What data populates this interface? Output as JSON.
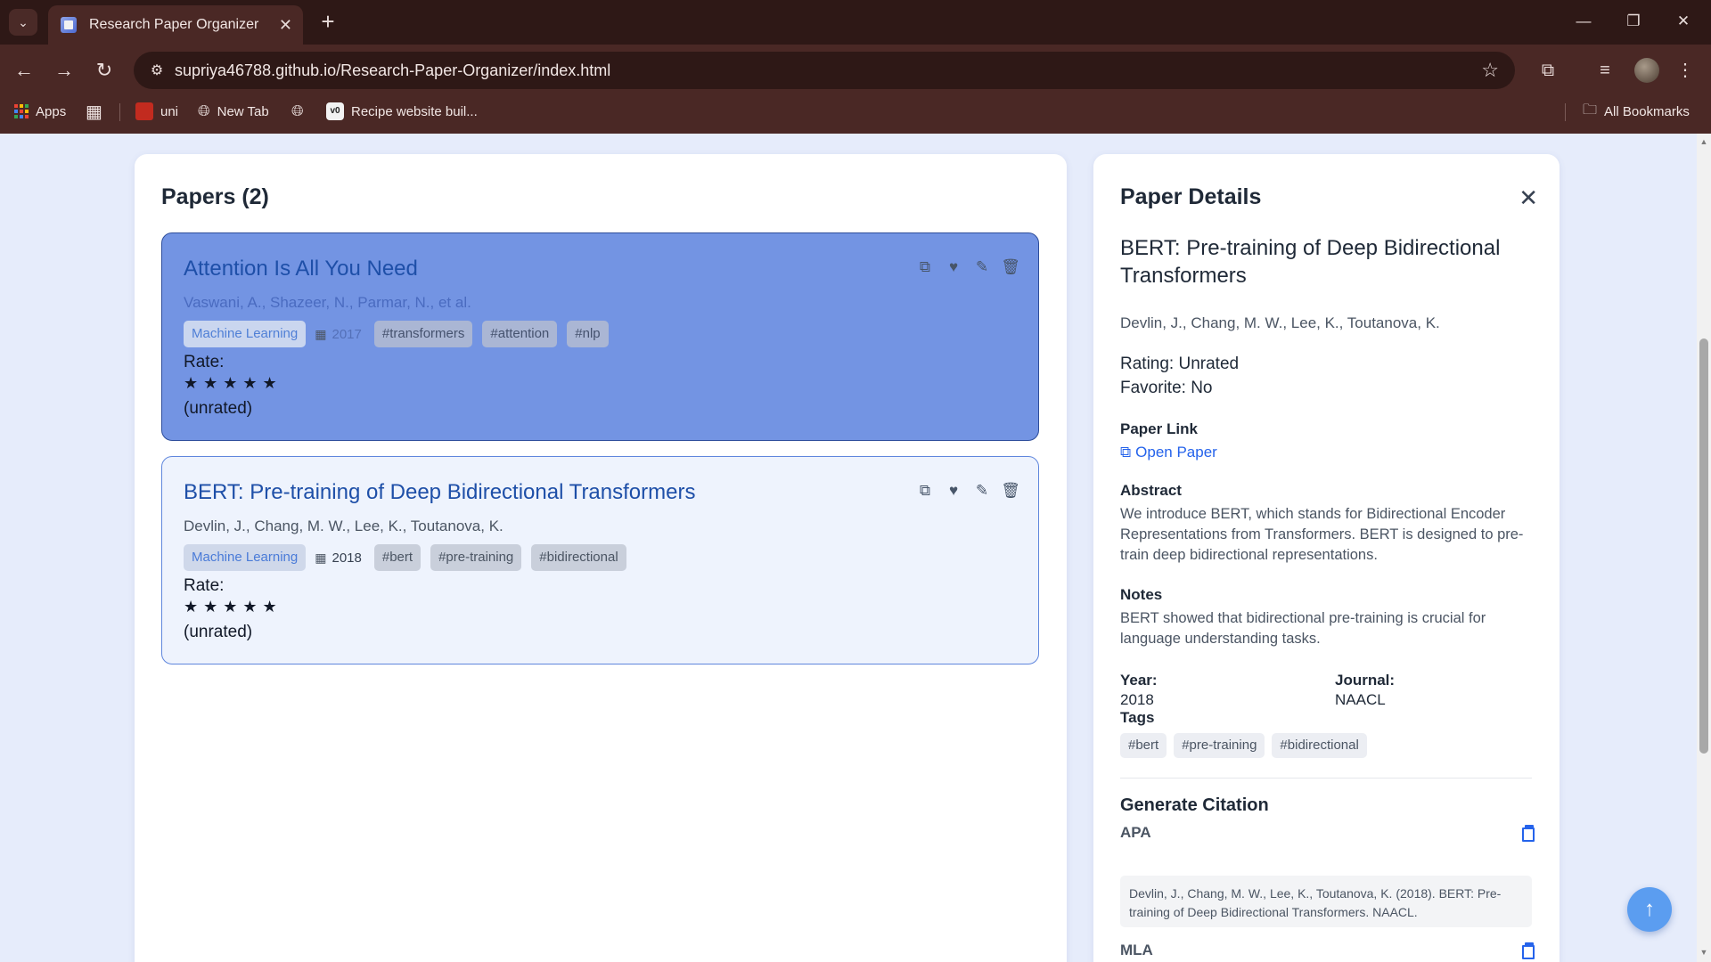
{
  "browser": {
    "tab_title": "Research Paper Organizer",
    "url": "supriya46788.github.io/Research-Paper-Organizer/index.html",
    "bookmarks": {
      "apps": "Apps",
      "uni": "uni",
      "new_tab": "New Tab",
      "recipe": "Recipe website buil...",
      "all_bookmarks": "All Bookmarks"
    }
  },
  "papers": {
    "heading": "Papers (2)",
    "rate_label": "Rate:",
    "unrated_label": "(unrated)",
    "stars": "★★★★★",
    "items": [
      {
        "title": "Attention Is All You Need",
        "authors": "Vaswani, A., Shazeer, N., Parmar, N., et al.",
        "category": "Machine Learning",
        "year": "2017",
        "tags": [
          "#transformers",
          "#attention",
          "#nlp"
        ],
        "selected": true
      },
      {
        "title": "BERT: Pre-training of Deep Bidirectional Transformers",
        "authors": "Devlin, J., Chang, M. W., Lee, K., Toutanova, K.",
        "category": "Machine Learning",
        "year": "2018",
        "tags": [
          "#bert",
          "#pre-training",
          "#bidirectional"
        ],
        "selected": false
      }
    ]
  },
  "details": {
    "heading": "Paper Details",
    "title": "BERT: Pre-training of Deep Bidirectional Transformers",
    "authors": "Devlin, J., Chang, M. W., Lee, K., Toutanova, K.",
    "rating_label": "Rating:",
    "rating_value": "Unrated",
    "favorite_label": "Favorite:",
    "favorite_value": "No",
    "paper_link_label": "Paper Link",
    "open_paper": "Open Paper",
    "abstract_label": "Abstract",
    "abstract": "We introduce BERT, which stands for Bidirectional Encoder Representations from Transformers. BERT is designed to pre-train deep bidirectional representations.",
    "notes_label": "Notes",
    "notes": "BERT showed that bidirectional pre-training is crucial for language understanding tasks.",
    "year_label": "Year:",
    "year": "2018",
    "journal_label": "Journal:",
    "journal": "NAACL",
    "tags_label": "Tags",
    "tags": [
      "#bert",
      "#pre-training",
      "#bidirectional"
    ],
    "citation_heading": "Generate Citation",
    "apa_label": "APA",
    "apa_text": "Devlin, J., Chang, M. W., Lee, K., Toutanova, K. (2018). BERT: Pre-training of Deep Bidirectional Transformers. NAACL.",
    "mla_label": "MLA"
  },
  "colors": {
    "selected_card": "#7394e3",
    "normal_card": "#eef3fd",
    "accent": "#2563eb",
    "page_bg": "#e6ecfb"
  }
}
